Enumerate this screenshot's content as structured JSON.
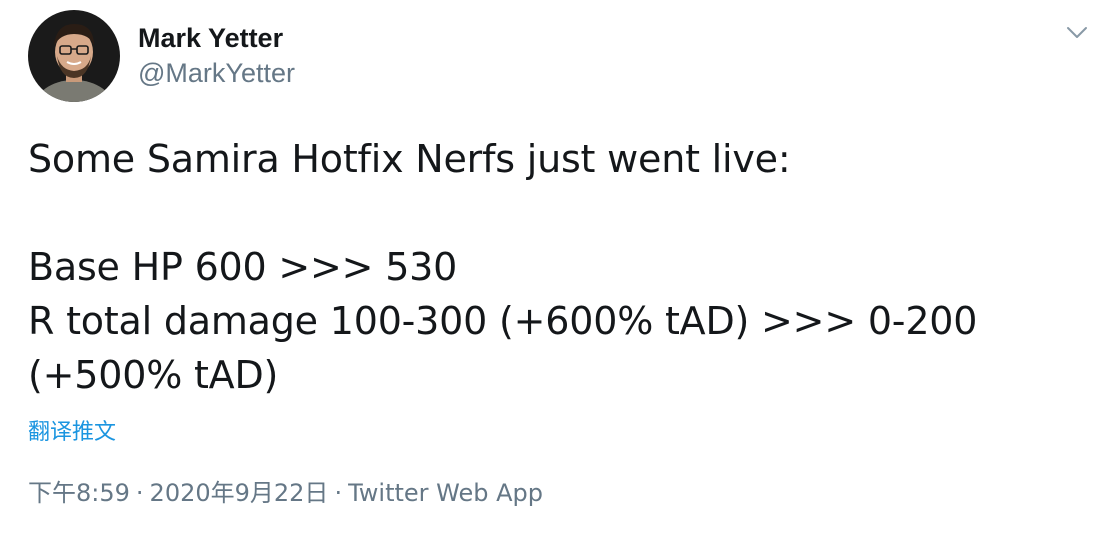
{
  "author": {
    "display_name": "Mark Yetter",
    "handle": "@MarkYetter"
  },
  "tweet": {
    "line1": "Some Samira Hotfix Nerfs just went live:",
    "line2": "Base HP 600 >>> 530",
    "line3": "R total damage 100-300 (+600% tAD) >>> 0-200",
    "line4": "(+500% tAD)"
  },
  "translate_label": "翻译推文",
  "meta": {
    "time": "下午8:59",
    "separator": "·",
    "date": "2020年9月22日",
    "source": "Twitter Web App"
  },
  "icons": {
    "menu": "chevron-down-icon",
    "avatar": "profile-photo"
  },
  "colors": {
    "text": "#14171a",
    "secondary": "#657786",
    "link": "#1b95e0"
  }
}
